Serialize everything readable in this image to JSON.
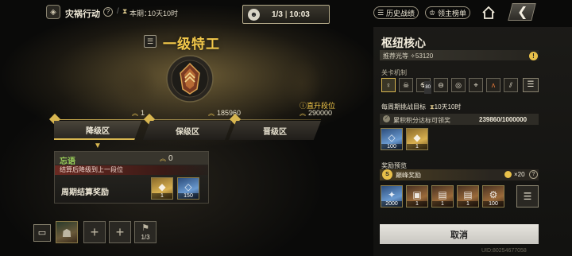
{
  "header": {
    "mode_title": "灾祸行动",
    "help": "?",
    "separator": "/",
    "period_label": "本期：",
    "period_value": "10天10时",
    "timer": {
      "progress": "1/3",
      "time": "10:03"
    },
    "history_button": "历史战绩",
    "leaderboard_button": "领主榜单"
  },
  "rank": {
    "title": "一级特工",
    "points_low": "1",
    "points_mid": "185960",
    "direct_up_label": "直升段位",
    "points_high": "290000",
    "zones": [
      "降级区",
      "保级区",
      "晋级区"
    ]
  },
  "status": {
    "rank_name": "忘语",
    "points": "0",
    "note": "结算后降级到上一段位",
    "reward_label": "周期结算奖励",
    "rewards": [
      {
        "count": "1",
        "icon": "gold-chest-icon",
        "style": "gold"
      },
      {
        "count": "150",
        "icon": "crystal-icon",
        "style": "blue"
      }
    ]
  },
  "team": {
    "flag_count": "1/3",
    "add": "+"
  },
  "panel": {
    "title": "枢纽核心",
    "recommended": "推荐光等 ✧53120",
    "mechanics_label": "关卡机制",
    "mechanics": [
      {
        "icon": "agent-icon",
        "badge": ""
      },
      {
        "icon": "skull-icon",
        "badge": ""
      },
      {
        "icon": "boss-icon",
        "badge": "80"
      },
      {
        "icon": "minus-circle-icon",
        "badge": ""
      },
      {
        "icon": "target-icon",
        "badge": ""
      },
      {
        "icon": "crosshair-icon",
        "badge": ""
      },
      {
        "icon": "fire-icon",
        "badge": ""
      },
      {
        "icon": "slash-icon",
        "badge": ""
      }
    ],
    "weekly_label": "每周期挑战目标",
    "weekly_time": "10天10时",
    "claim_text": "累积积分达标可领奖",
    "claim_progress": "239860/1000000",
    "weekly_rewards": [
      {
        "count": "100",
        "icon": "crystal-icon",
        "style": "blue"
      },
      {
        "count": "1",
        "icon": "gold-chest-icon",
        "style": "gold"
      }
    ],
    "preview_label": "奖励预览",
    "peak_label": "巅峰奖励",
    "peak_coins": "×20",
    "preview_rewards": [
      {
        "count": "2000",
        "icon": "wings-badge-icon",
        "style": "blue"
      },
      {
        "count": "1",
        "icon": "cube-icon",
        "style": "brown"
      },
      {
        "count": "1",
        "icon": "chest-icon",
        "style": "brown"
      },
      {
        "count": "1",
        "icon": "chest-icon",
        "style": "brown"
      },
      {
        "count": "100",
        "icon": "gear-icon",
        "style": "brown"
      }
    ],
    "cancel": "取消",
    "uid": "UID:80254677058"
  }
}
